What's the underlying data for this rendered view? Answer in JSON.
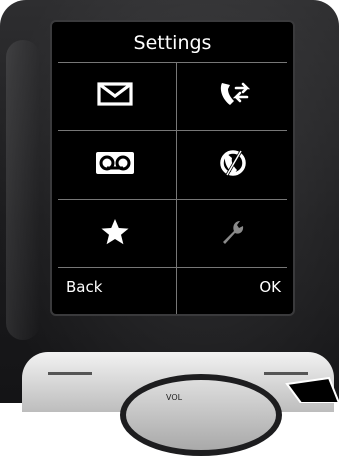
{
  "screen": {
    "title": "Settings",
    "icons": [
      {
        "name": "envelope-icon"
      },
      {
        "name": "call-transfer-icon"
      },
      {
        "name": "voicemail-icon"
      },
      {
        "name": "call-divert-icon"
      },
      {
        "name": "star-icon"
      },
      {
        "name": "wrench-icon"
      }
    ],
    "softkeys": {
      "left": "Back",
      "right": "OK"
    }
  },
  "hardware": {
    "nav_key_label": "VOL"
  },
  "colors": {
    "screen_bg": "#000000",
    "text": "#ffffff",
    "wrench_disabled": "#8a8a8a",
    "divider": "#777777"
  }
}
